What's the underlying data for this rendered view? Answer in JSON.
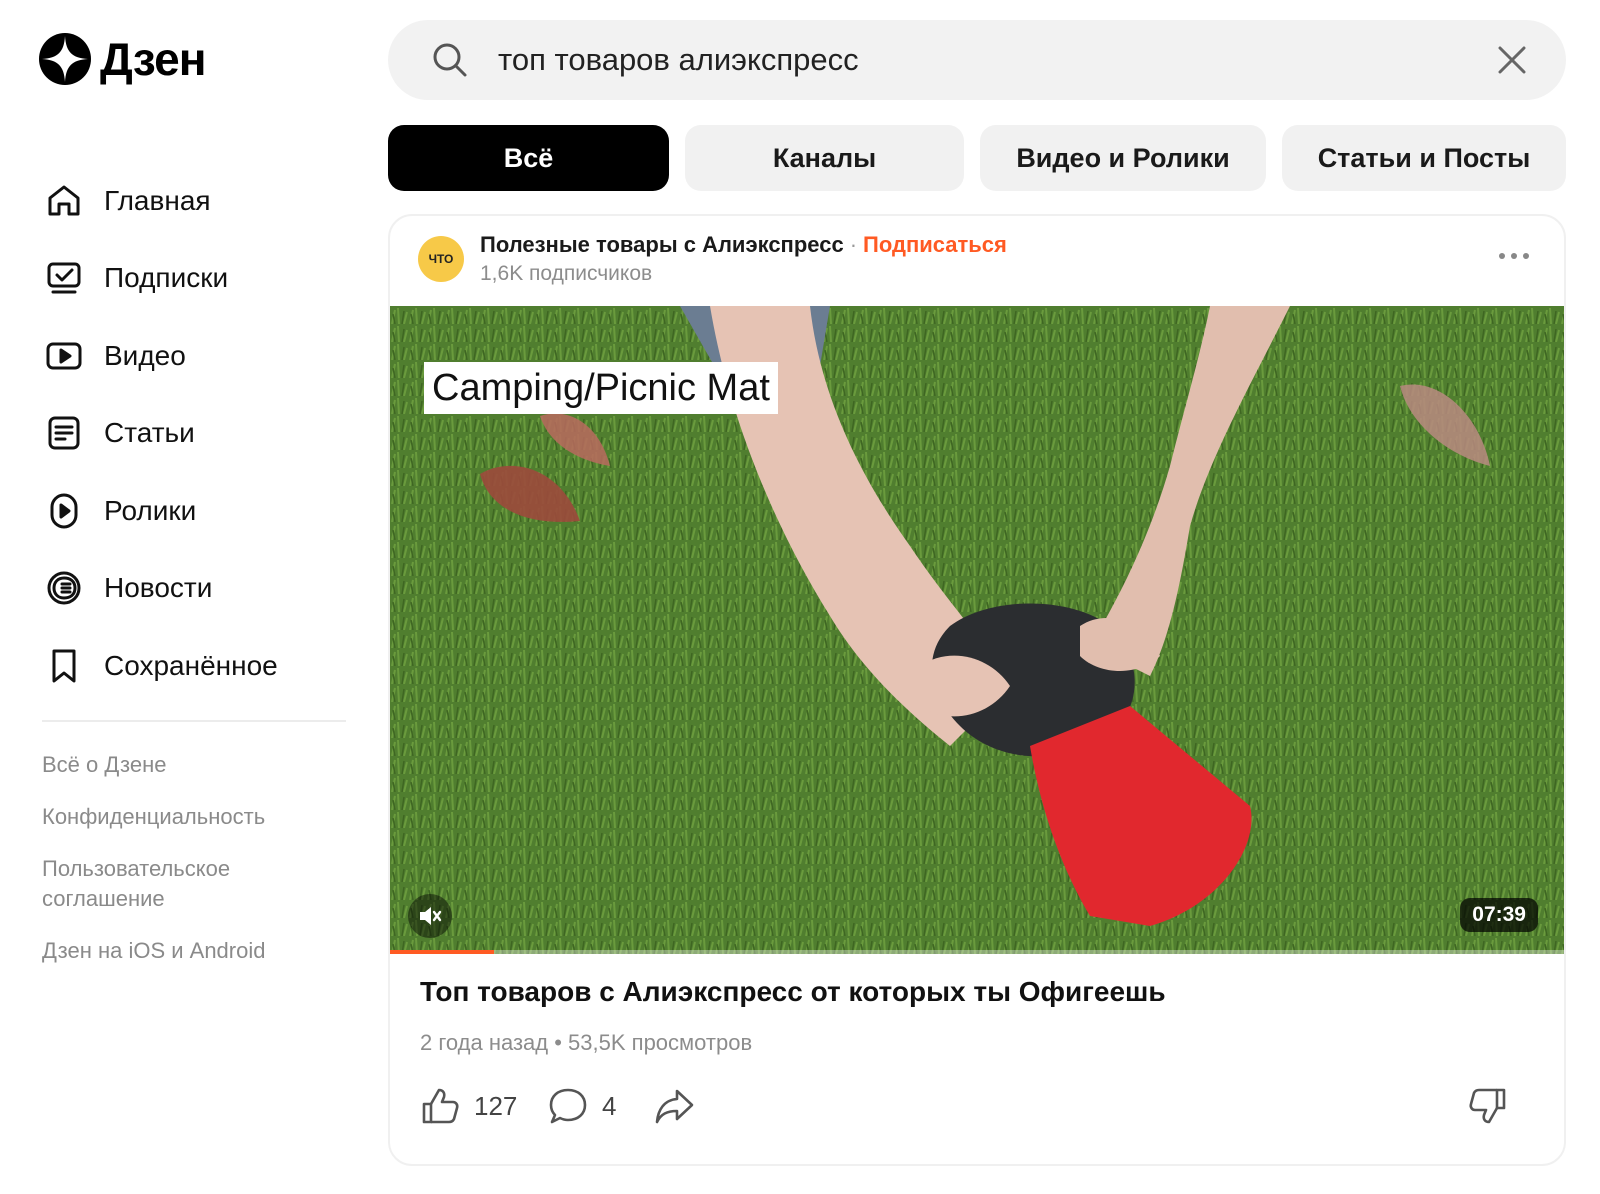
{
  "app": {
    "logo_text": "Дзен",
    "accent_color": "#ff5a23"
  },
  "sidebar": {
    "items": [
      {
        "label": "Главная",
        "icon": "home-icon"
      },
      {
        "label": "Подписки",
        "icon": "subscriptions-icon"
      },
      {
        "label": "Видео",
        "icon": "video-icon"
      },
      {
        "label": "Статьи",
        "icon": "articles-icon"
      },
      {
        "label": "Ролики",
        "icon": "shorts-icon"
      },
      {
        "label": "Новости",
        "icon": "news-icon"
      },
      {
        "label": "Сохранённое",
        "icon": "bookmark-icon"
      }
    ],
    "footer_links": [
      "Всё о Дзене",
      "Конфиденциальность",
      "Пользовательское соглашение",
      "Дзен на iOS и Android"
    ]
  },
  "search": {
    "value": "топ товаров алиэкспресс"
  },
  "tabs": [
    {
      "label": "Всё",
      "active": true
    },
    {
      "label": "Каналы",
      "active": false
    },
    {
      "label": "Видео и Ролики",
      "active": false
    },
    {
      "label": "Статьи и Посты",
      "active": false
    }
  ],
  "card": {
    "avatar_text": "ЧТО",
    "channel_name": "Полезные товары с Алиэкспресс",
    "separator": "·",
    "subscribe_label": "Подписаться",
    "subscribers": "1,6K подписчиков",
    "video": {
      "caption": "Camping/Picnic Mat",
      "duration": "07:39",
      "progress": 0.088,
      "muted": true
    },
    "title": "Топ товаров с Алиэкспресс от которых ты Офигеешь",
    "meta": "2 года назад • 53,5K просмотров",
    "likes": "127",
    "comments": "4"
  }
}
